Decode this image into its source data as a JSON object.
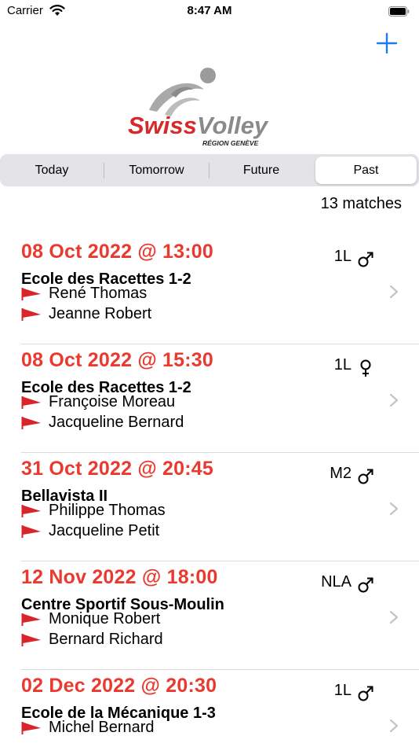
{
  "status_bar": {
    "carrier": "Carrier",
    "time": "8:47 AM"
  },
  "header": {
    "add_button": "+"
  },
  "logo": {
    "line1_a": "Swiss",
    "line1_b": "Volley",
    "line2": "RÉGION GENÈVE"
  },
  "tabs": [
    {
      "label": "Today",
      "selected": false
    },
    {
      "label": "Tomorrow",
      "selected": false
    },
    {
      "label": "Future",
      "selected": false
    },
    {
      "label": "Past",
      "selected": true
    }
  ],
  "match_count": "13 matches",
  "colors": {
    "accent": "#1a7cf5",
    "date": "#ea3a2f",
    "flag": "#d9252a"
  },
  "matches": [
    {
      "date": "08 Oct 2022 @ 13:00",
      "venue": "Ecole des Racettes 1-2",
      "referees": [
        "René Thomas",
        "Jeanne Robert"
      ],
      "league": "1L",
      "gender": "male-icon"
    },
    {
      "date": "08 Oct 2022 @ 15:30",
      "venue": "Ecole des Racettes 1-2",
      "referees": [
        "Françoise Moreau",
        "Jacqueline Bernard"
      ],
      "league": "1L",
      "gender": "female-icon"
    },
    {
      "date": "31 Oct 2022 @ 20:45",
      "venue": "Bellavista II",
      "referees": [
        "Philippe Thomas",
        "Jacqueline Petit"
      ],
      "league": "M2",
      "gender": "male-icon"
    },
    {
      "date": "12 Nov 2022 @ 18:00",
      "venue": "Centre Sportif Sous-Moulin",
      "referees": [
        "Monique Robert",
        "Bernard Richard"
      ],
      "league": "NLA",
      "gender": "male-icon"
    },
    {
      "date": "02 Dec 2022 @ 20:30",
      "venue": "Ecole de la Mécanique 1-3",
      "referees": [
        "Michel Bernard",
        ""
      ],
      "league": "1L",
      "gender": "male-icon"
    }
  ]
}
